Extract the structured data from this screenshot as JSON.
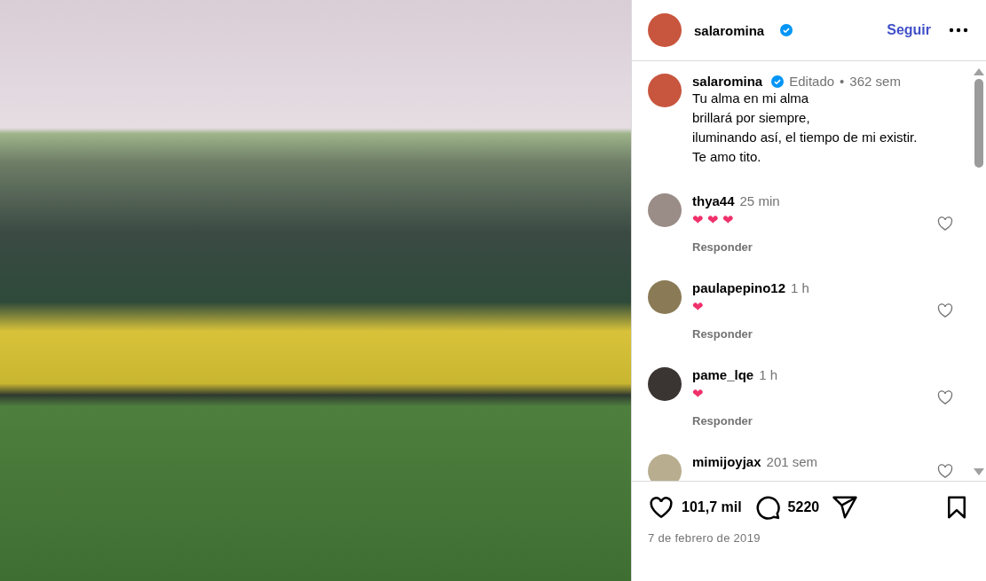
{
  "post": {
    "author": {
      "username": "salaromina",
      "verified": true
    },
    "follow_label": "Seguir"
  },
  "caption": {
    "username": "salaromina",
    "verified": true,
    "edited": "Editado",
    "separator": "•",
    "time": "362 sem",
    "lines": [
      "Tu alma en mi alma",
      "brillará por siempre,",
      "iluminando así, el tiempo de mi existir.",
      "Te amo tito."
    ]
  },
  "comments": [
    {
      "username": "thya44",
      "time": "25 min",
      "text": "❤❤❤",
      "reply": "Responder",
      "liked": false
    },
    {
      "username": "paulapepino12",
      "time": "1 h",
      "text": "❤",
      "reply": "Responder",
      "liked": false
    },
    {
      "username": "pame_lqe",
      "time": "1 h",
      "text": "❤",
      "reply": "Responder",
      "liked": false
    },
    {
      "username": "mimijoyjax",
      "time": "201 sem",
      "liked": false
    }
  ],
  "actions": {
    "likes": "101,7 mil",
    "comments": "5220",
    "liked": false,
    "saved": false
  },
  "date": "7 de febrero de 2019"
}
